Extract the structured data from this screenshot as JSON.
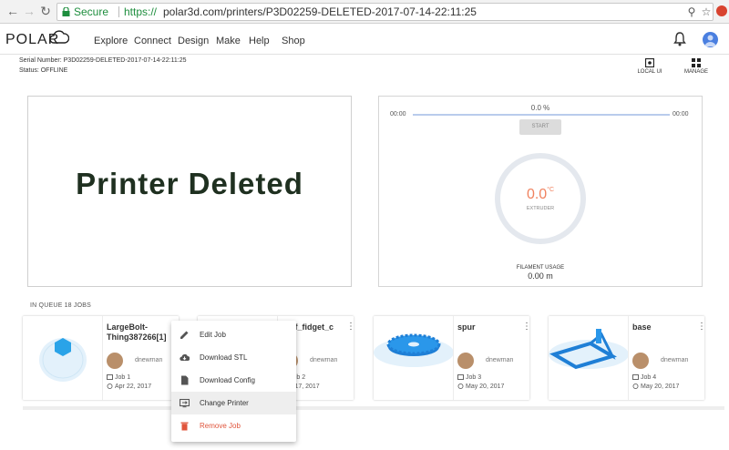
{
  "browser": {
    "secure_label": "Secure",
    "url_scheme": "https://",
    "url_rest": "polar3d.com/printers/P3D02259-DELETED-2017-07-14-22:11:25"
  },
  "header": {
    "logo_text": "POLAR",
    "nav": [
      "Explore",
      "Connect",
      "Design",
      "Make",
      "Help",
      "Shop"
    ]
  },
  "printer": {
    "serial_line": "Serial Number: P3D02259-DELETED-2017-07-14-22:11:25",
    "status_line": "Status: OFFLINE",
    "image_text": "Printer Deleted"
  },
  "tools": {
    "local_ui": "LOCAL UI",
    "manage": "MANAGE"
  },
  "control": {
    "progress": "0.0 %",
    "time_elapsed": "00:00",
    "time_remaining": "00:00",
    "start_label": "START",
    "temp_value": "0.0",
    "temp_unit": "°C",
    "temp_label": "EXTRUDER",
    "filament_label": "FILAMENT USAGE",
    "filament_value": "0.00 m"
  },
  "queue": {
    "title": "IN QUEUE 18 JOBS",
    "jobs": [
      {
        "title": "LargeBolt-Thing387266[1]",
        "owner": "dnewman",
        "job": "Job 1",
        "date": "Apr 22, 2017"
      },
      {
        "title": "roof_fidget_c",
        "owner": "dnewman",
        "job": "Job 2",
        "date": "y 17, 2017"
      },
      {
        "title": "spur",
        "owner": "dnewman",
        "job": "Job 3",
        "date": "May 20, 2017"
      },
      {
        "title": "base",
        "owner": "dnewman",
        "job": "Job 4",
        "date": "May 20, 2017"
      }
    ]
  },
  "menu": {
    "items": [
      "Edit Job",
      "Download STL",
      "Download Config",
      "Change Printer",
      "Remove Job"
    ]
  },
  "colors": {
    "accent": "#4a7fe0",
    "danger": "#e0553c",
    "secure_green": "#1e8e3e",
    "temp_orange": "#f0825f"
  }
}
